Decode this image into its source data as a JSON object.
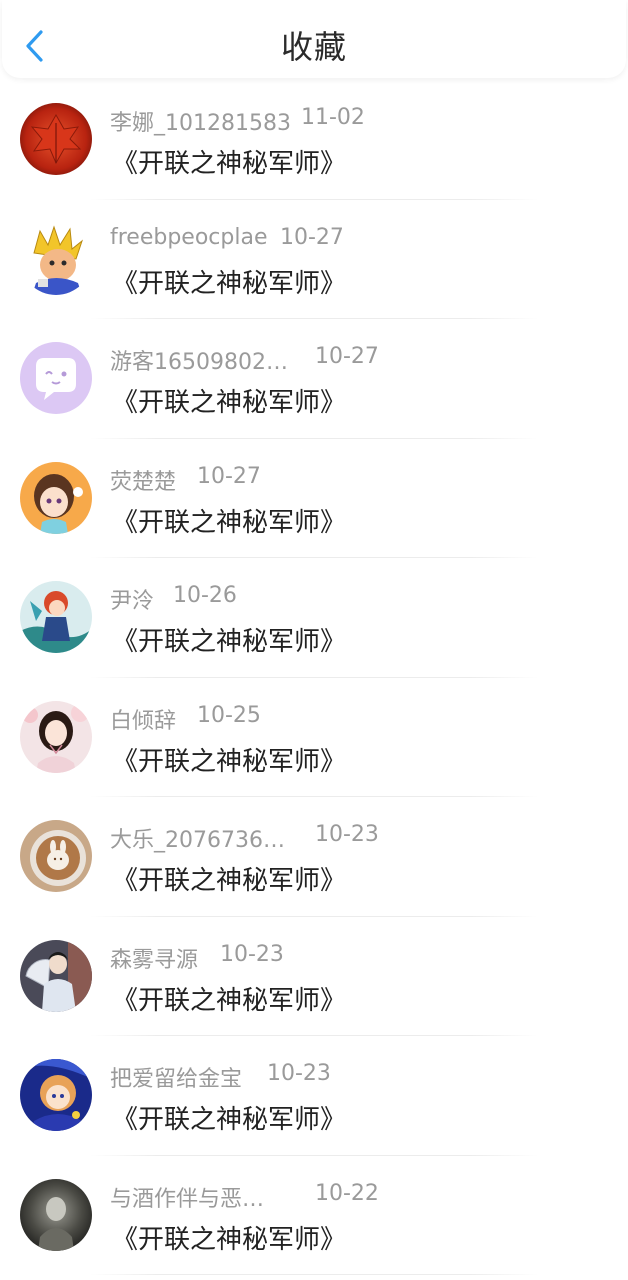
{
  "header": {
    "title": "收藏",
    "back_icon": "chevron-left-icon",
    "accent_color": "#2f9bf0"
  },
  "favorites": [
    {
      "user": "李娜_101281583",
      "date": "11-02",
      "title": "《开联之神秘军师》",
      "avatar": "red-leaf-avatar"
    },
    {
      "user": "freebpeocplae",
      "date": "10-27",
      "title": "《开联之神秘军师》",
      "avatar": "cartoon-hero-avatar"
    },
    {
      "user": "游客16509802…",
      "date": "10-27",
      "title": "《开联之神秘军师》",
      "avatar": "purple-chat-bubble-avatar"
    },
    {
      "user": "荧楚楚",
      "date": "10-27",
      "title": "《开联之神秘军师》",
      "avatar": "anime-girl-avatar"
    },
    {
      "user": "尹泠",
      "date": "10-26",
      "title": "《开联之神秘军师》",
      "avatar": "anime-boy-avatar"
    },
    {
      "user": "白倾辞",
      "date": "10-25",
      "title": "《开联之神秘军师》",
      "avatar": "girl-portrait-avatar"
    },
    {
      "user": "大乐_2076736…",
      "date": "10-23",
      "title": "《开联之神秘军师》",
      "avatar": "latte-art-avatar"
    },
    {
      "user": "森雾寻源",
      "date": "10-23",
      "title": "《开联之神秘军师》",
      "avatar": "person-with-fan-avatar"
    },
    {
      "user": "把爱留给金宝",
      "date": "10-23",
      "title": "《开联之神秘军师》",
      "avatar": "anime-blue-avatar"
    },
    {
      "user": "与酒作伴与恶…",
      "date": "10-22",
      "title": "《开联之神秘军师》",
      "avatar": "dark-photo-avatar"
    }
  ]
}
